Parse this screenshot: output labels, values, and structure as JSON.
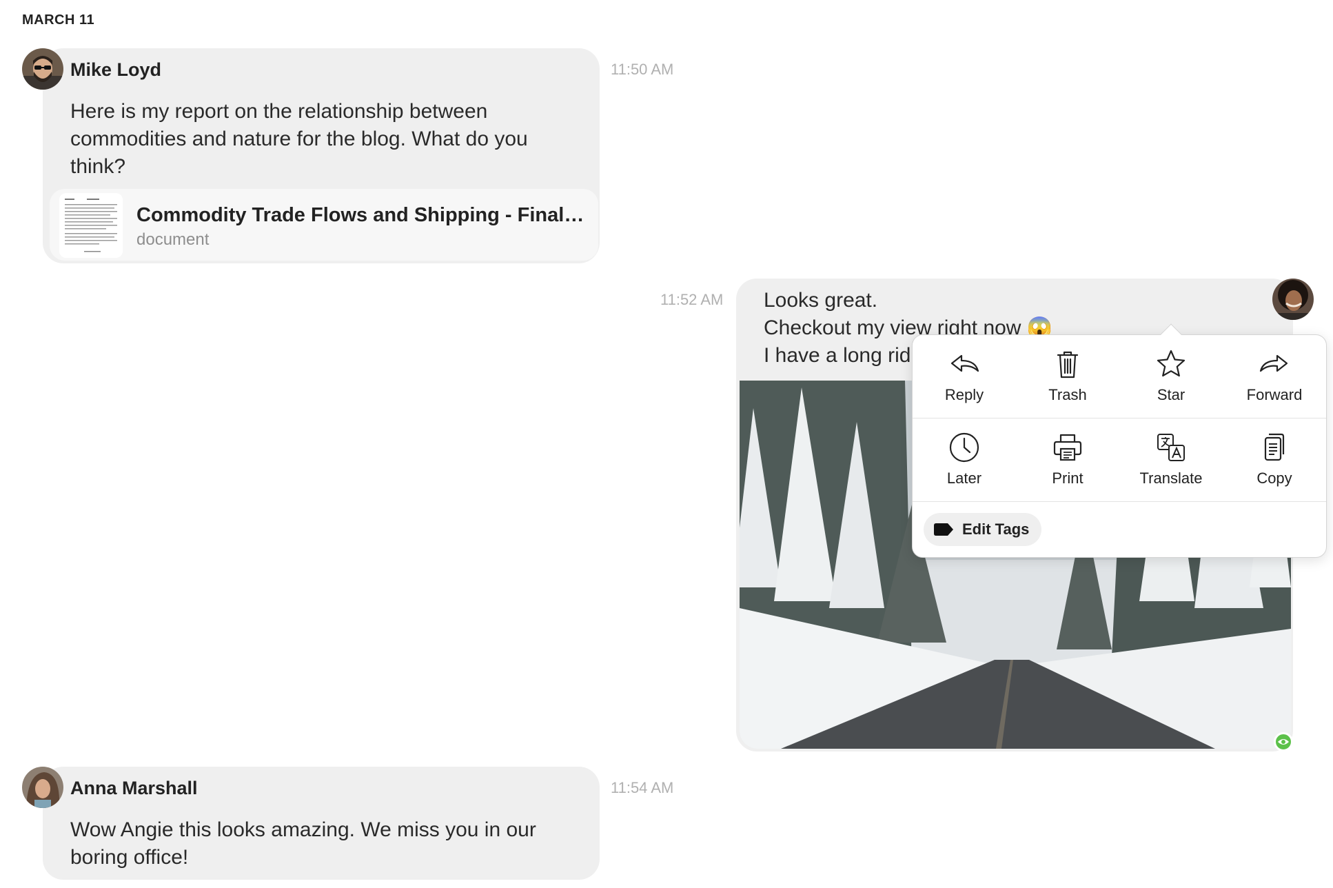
{
  "date_header": "MARCH 11",
  "messages": [
    {
      "sender": "Mike Loyd",
      "time": "11:50 AM",
      "text_lines": [
        "Here is my report on the relationship between",
        "commodities and nature for the blog. What do you",
        "think?"
      ],
      "attachment": {
        "title": "Commodity Trade Flows and Shipping - Final …",
        "type": "document"
      }
    },
    {
      "time": "11:52 AM",
      "text_lines": [
        "Looks great.",
        "Checkout my view right now 😱",
        "I have a long rid"
      ]
    },
    {
      "sender": "Anna Marshall",
      "time": "11:54 AM",
      "text_lines": [
        "Wow Angie this looks amazing. We miss you in our",
        "boring office!"
      ]
    }
  ],
  "context_menu": {
    "actions": [
      {
        "label": "Reply",
        "icon": "reply-icon"
      },
      {
        "label": "Trash",
        "icon": "trash-icon"
      },
      {
        "label": "Star",
        "icon": "star-icon"
      },
      {
        "label": "Forward",
        "icon": "forward-icon"
      },
      {
        "label": "Later",
        "icon": "clock-icon"
      },
      {
        "label": "Print",
        "icon": "printer-icon"
      },
      {
        "label": "Translate",
        "icon": "translate-icon"
      },
      {
        "label": "Copy",
        "icon": "copy-icon"
      }
    ],
    "edit_tags_label": "Edit Tags"
  },
  "colors": {
    "bubble": "#efefef",
    "timestamp": "#b0b0b0",
    "seen_badge": "#5cc14a"
  }
}
